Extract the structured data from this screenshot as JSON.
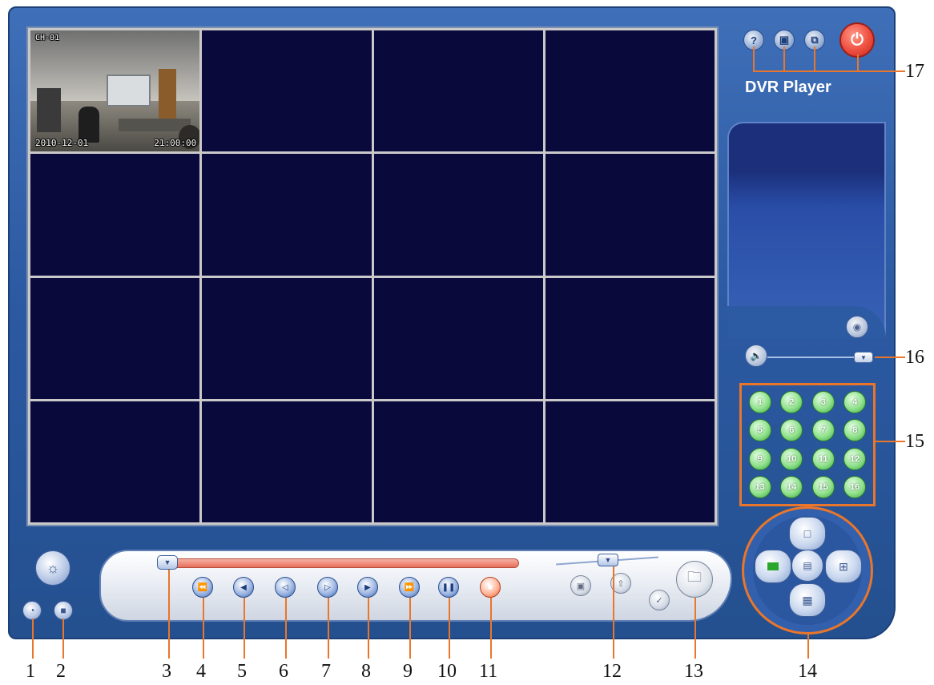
{
  "app": {
    "title": "DVR Player"
  },
  "camera": {
    "title_overlay": "CH-01",
    "date": "2010-12-01",
    "time": "21:00:00"
  },
  "top_buttons": {
    "help_label": "?",
    "btn2_icon": "monitor-icon",
    "btn3_icon": "window-icon",
    "power_icon": "power-icon"
  },
  "channels": [
    "1",
    "2",
    "3",
    "4",
    "5",
    "6",
    "7",
    "8",
    "9",
    "10",
    "11",
    "12",
    "13",
    "14",
    "15",
    "16"
  ],
  "callouts": {
    "n1": "1",
    "n2": "2",
    "n3": "3",
    "n4": "4",
    "n5": "5",
    "n6": "6",
    "n7": "7",
    "n8": "8",
    "n9": "9",
    "n10": "10",
    "n11": "11",
    "n12": "12",
    "n13": "13",
    "n14": "14",
    "n15": "15",
    "n16": "16",
    "n17": "17"
  },
  "icons": {
    "settings": "gear-icon",
    "disk": "disk-icon",
    "save": "save-icon",
    "rewind_fast": "fast-rewind-icon",
    "rewind": "rewind-icon",
    "step_back": "step-back-icon",
    "step_forward": "step-forward-icon",
    "play": "play-icon",
    "fast_forward": "fast-forward-icon",
    "pause": "pause-icon",
    "stop": "stop-icon",
    "snapshot": "camera-icon",
    "backup": "upload-icon",
    "check": "check-icon",
    "folder": "folder-icon",
    "speaker": "speaker-icon",
    "audio": "audio-icon"
  },
  "colors": {
    "frame": "#2c5aa3",
    "video_bg": "#09093b",
    "callout": "#e9762b",
    "channel_green": "#37a53a",
    "power_red": "#ee4e3e"
  }
}
